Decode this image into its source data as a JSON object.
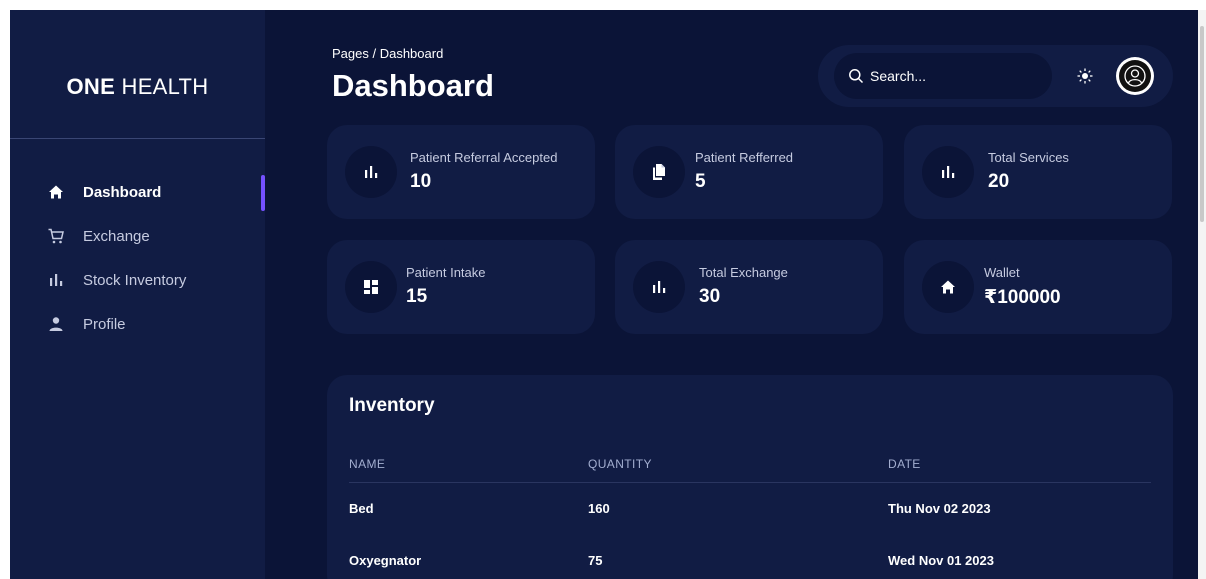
{
  "brand": {
    "bold": "ONE",
    "light": "HEALTH"
  },
  "sidebar": {
    "items": [
      {
        "label": "Dashboard",
        "icon": "home-icon",
        "active": true
      },
      {
        "label": "Exchange",
        "icon": "cart-icon",
        "active": false
      },
      {
        "label": "Stock Inventory",
        "icon": "bar-chart-icon",
        "active": false
      },
      {
        "label": "Profile",
        "icon": "person-icon",
        "active": false
      }
    ]
  },
  "header": {
    "breadcrumb": "Pages / Dashboard",
    "title": "Dashboard",
    "search_placeholder": "Search..."
  },
  "stats": [
    {
      "label": "Patient Referral Accepted",
      "value": "10",
      "icon": "bar-chart-icon"
    },
    {
      "label": "Patient Refferred",
      "value": "5",
      "icon": "documents-icon"
    },
    {
      "label": "Total Services",
      "value": "20",
      "icon": "bar-chart-icon"
    },
    {
      "label": "Patient Intake",
      "value": "15",
      "icon": "dashboard-grid-icon"
    },
    {
      "label": "Total Exchange",
      "value": "30",
      "icon": "bar-chart-icon"
    },
    {
      "label": "Wallet",
      "value": "₹100000",
      "icon": "home-icon"
    }
  ],
  "inventory": {
    "title": "Inventory",
    "columns": [
      "NAME",
      "QUANTITY",
      "DATE"
    ],
    "rows": [
      {
        "name": "Bed",
        "quantity": "160",
        "date": "Thu Nov 02 2023"
      },
      {
        "name": "Oxyegnator",
        "quantity": "75",
        "date": "Wed Nov 01 2023"
      }
    ]
  },
  "colors": {
    "background": "#0b1437",
    "card": "#111c44",
    "accent": "#7551ff",
    "text_muted": "#a3aed0"
  }
}
